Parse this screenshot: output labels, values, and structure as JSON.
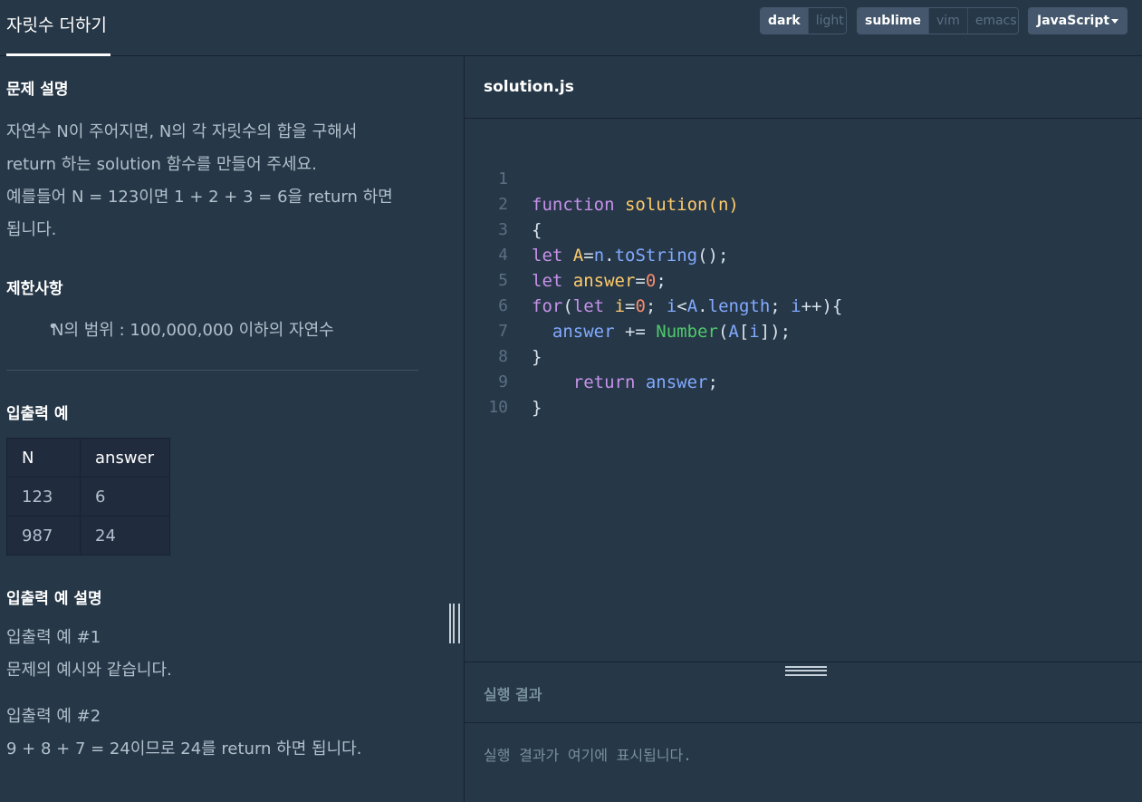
{
  "header": {
    "tab": "자릿수 더하기",
    "theme": [
      "dark",
      "light"
    ],
    "keymap": [
      "sublime",
      "vim",
      "emacs"
    ],
    "language": "JavaScript"
  },
  "problem": {
    "desc_title": "문제 설명",
    "desc_lines": [
      "자연수 N이 주어지면, N의 각 자릿수의 합을 구해서",
      "return 하는 solution 함수를 만들어 주세요.",
      "예를들어 N = 123이면 1 + 2 + 3 = 6을 return 하면",
      "됩니다."
    ],
    "constraints_title": "제한사항",
    "constraint": "N의 범위 : 100,000,000 이하의 자연수",
    "io_title": "입출력 예",
    "table": {
      "headers": [
        "N",
        "answer"
      ],
      "rows": [
        [
          "123",
          "6"
        ],
        [
          "987",
          "24"
        ]
      ]
    },
    "io_desc_title": "입출력 예 설명",
    "ex1_title": "입출력 예 #1",
    "ex1_text": "문제의 예시와 같습니다.",
    "ex2_title": "입출력 예 #2",
    "ex2_text": "9 + 8 + 7 = 24이므로 24를 return 하면 됩니다."
  },
  "editor": {
    "filename": "solution.js",
    "line_numbers": [
      "1",
      "2",
      "3",
      "4",
      "5",
      "6",
      "7",
      "8",
      "9",
      "10"
    ],
    "code": [
      "function solution(n)",
      "{",
      "let A=n.toString();",
      "let answer=0;",
      "for(let i=0; i<A.length; i++){",
      "  answer += Number(A[i]);",
      "}",
      "    return answer;",
      "}",
      ""
    ]
  },
  "result": {
    "title": "실행 결과",
    "placeholder": "실행 결과가 여기에 표시됩니다."
  }
}
